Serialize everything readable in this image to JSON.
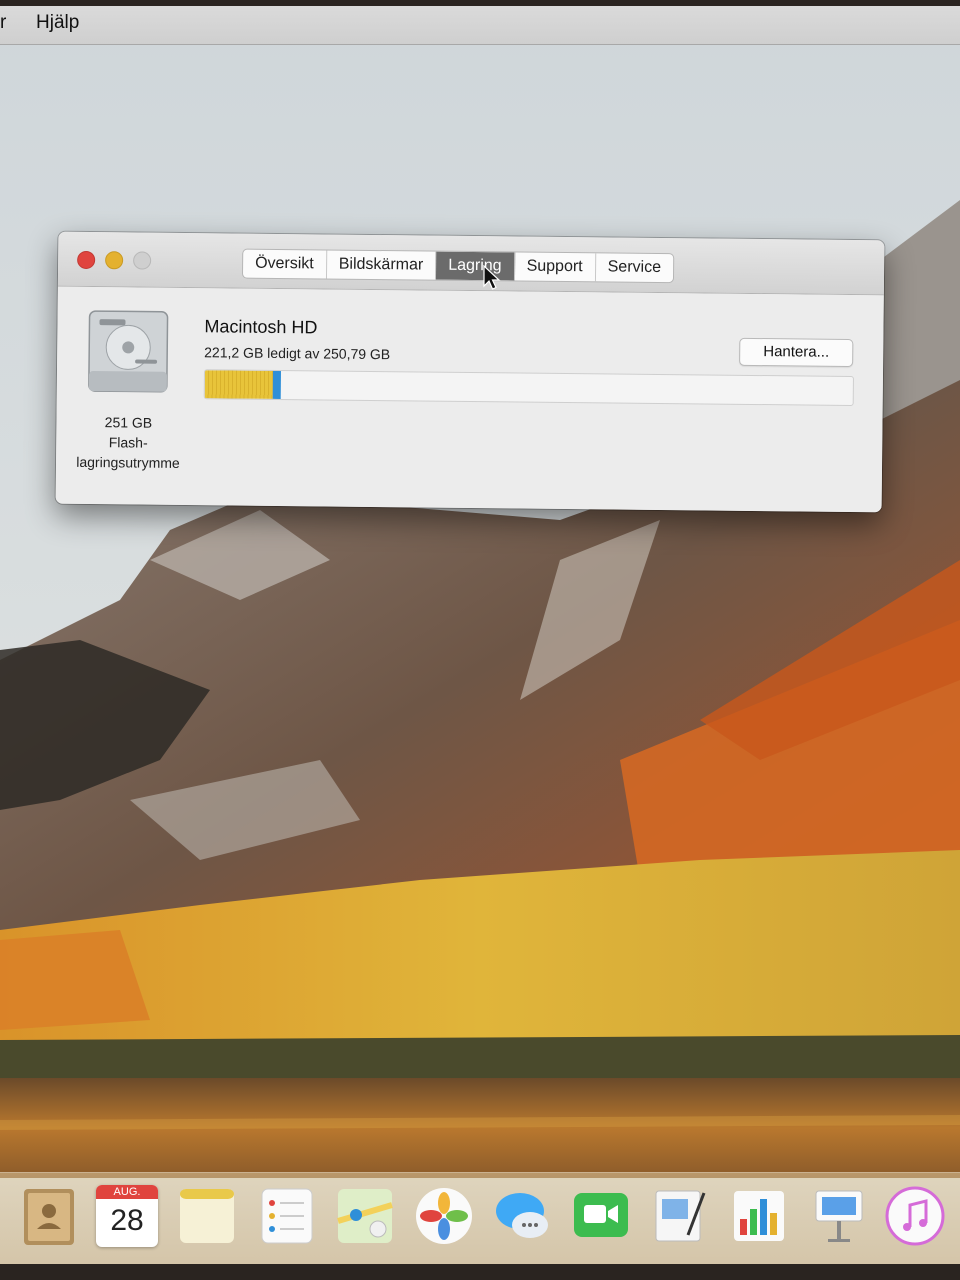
{
  "menubar": {
    "items": [
      "r",
      "Hjälp"
    ]
  },
  "window": {
    "tabs": [
      {
        "label": "Översikt",
        "active": false
      },
      {
        "label": "Bildskärmar",
        "active": false
      },
      {
        "label": "Lagring",
        "active": true
      },
      {
        "label": "Support",
        "active": false
      },
      {
        "label": "Service",
        "active": false
      }
    ],
    "disk": {
      "name": "Macintosh HD",
      "free_text": "221,2 GB ledigt av 250,79 GB",
      "caption_line1": "251 GB",
      "caption_line2": "Flash-",
      "caption_line3": "lagringsutrymme",
      "icon": "hard-drive-icon",
      "used_fraction": 0.118
    },
    "manage_label": "Hantera..."
  },
  "dock": {
    "calendar_month": "AUG.",
    "calendar_day": "28",
    "icons": [
      "contacts-icon",
      "calendar-icon",
      "notes-icon",
      "reminders-icon",
      "maps-icon",
      "photos-icon",
      "messages-icon",
      "facetime-icon",
      "keynote-preview-icon",
      "numbers-icon",
      "keynote-icon",
      "itunes-icon"
    ]
  },
  "colors": {
    "close": "#e0443e",
    "minimize": "#e4b12f",
    "active_tab": "#6b6b6b",
    "bar_yellow": "#e8c43a",
    "bar_blue": "#2f8fd8"
  }
}
